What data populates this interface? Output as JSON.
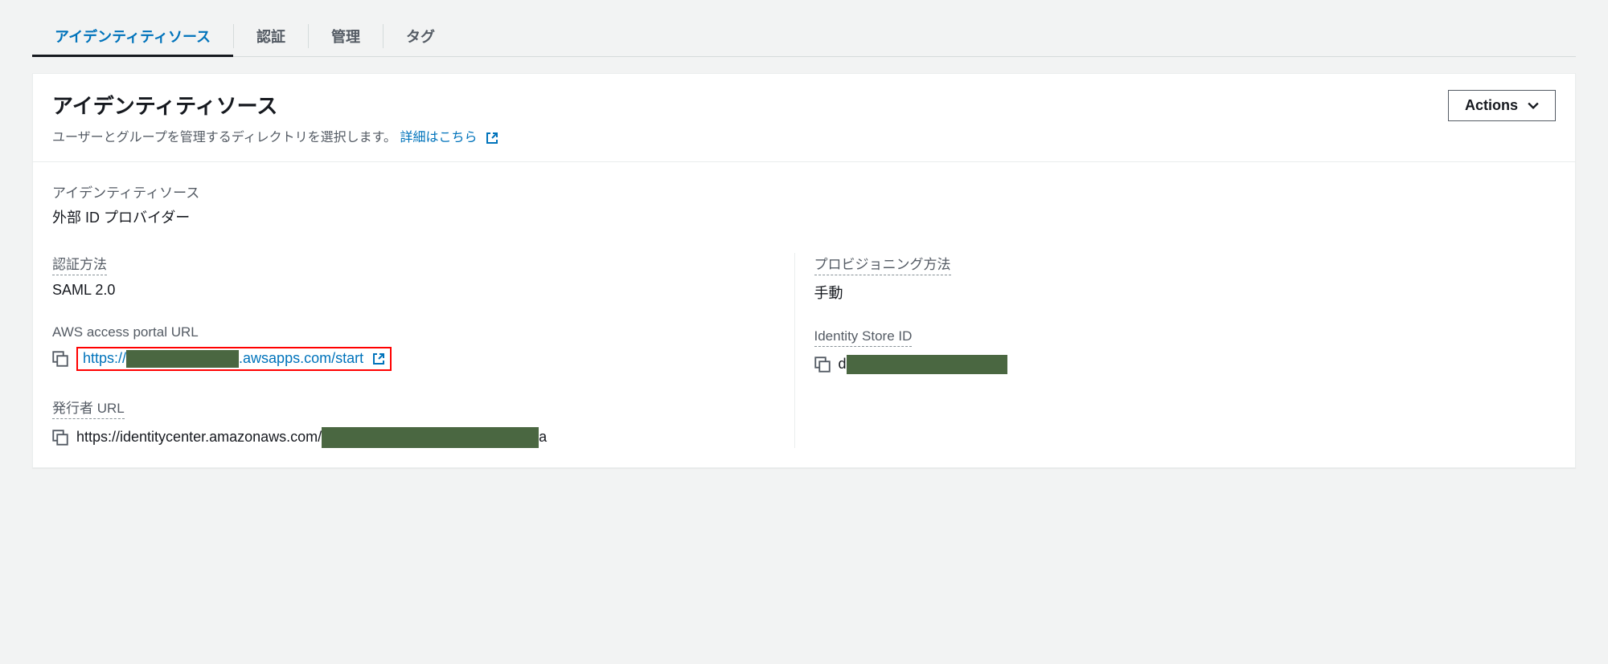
{
  "tabs": {
    "identity_source": "アイデンティティソース",
    "authentication": "認証",
    "management": "管理",
    "tags": "タグ"
  },
  "panel": {
    "title": "アイデンティティソース",
    "desc": "ユーザーとグループを管理するディレクトリを選択します。",
    "learn_more": "詳細はこちら",
    "actions_label": "Actions"
  },
  "fields": {
    "identity_source": {
      "label": "アイデンティティソース",
      "value": "外部 ID プロバイダー"
    },
    "auth_method": {
      "label": "認証方法",
      "value": "SAML 2.0"
    },
    "provisioning": {
      "label": "プロビジョニング方法",
      "value": "手動"
    },
    "portal_url": {
      "label": "AWS access portal URL",
      "prefix": "https://",
      "suffix": ".awsapps.com/start"
    },
    "identity_store": {
      "label": "Identity Store ID",
      "prefix": "d"
    },
    "issuer_url": {
      "label": "発行者 URL",
      "prefix": "https://identitycenter.amazonaws.com/",
      "suffix": "a"
    }
  }
}
